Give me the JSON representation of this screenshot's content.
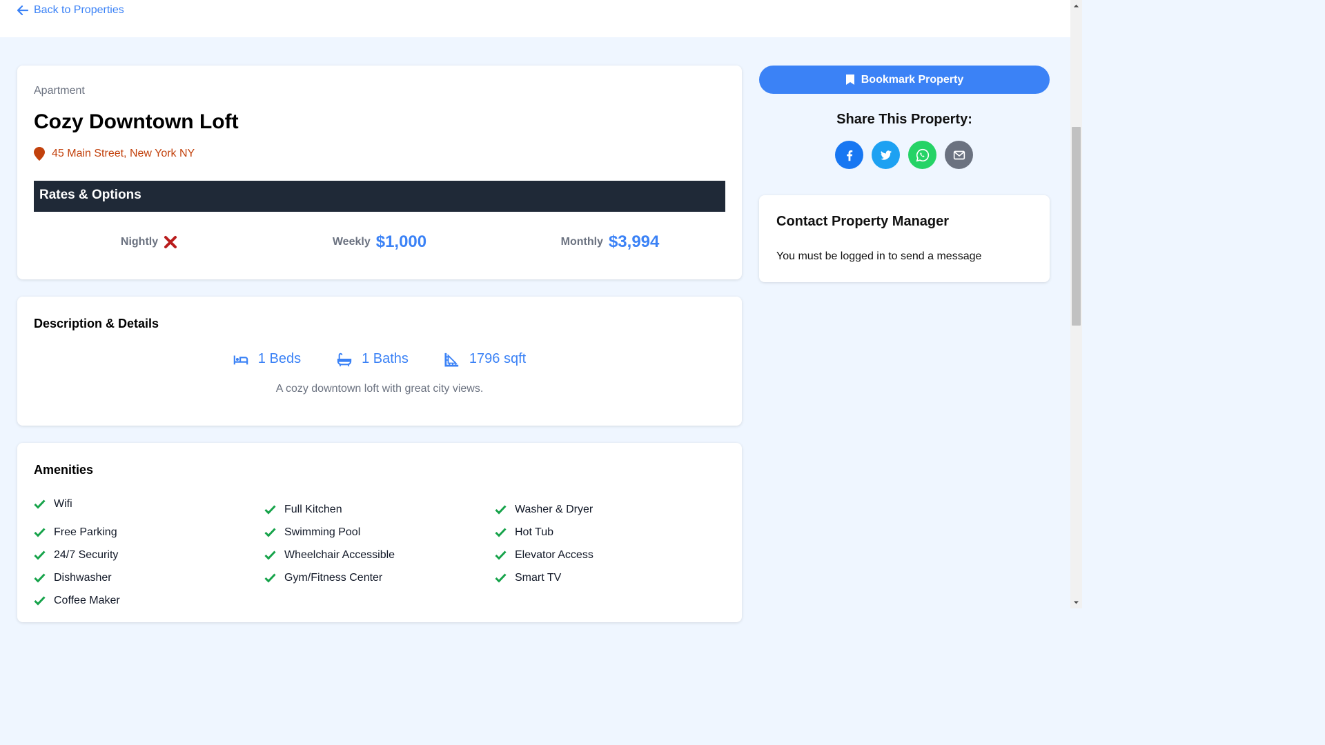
{
  "nav": {
    "back_label": "Back to Properties"
  },
  "property": {
    "type": "Apartment",
    "title": "Cozy Downtown Loft",
    "address": "45 Main Street, New York NY"
  },
  "rates": {
    "header": "Rates & Options",
    "nightly_label": "Nightly",
    "nightly_available": false,
    "weekly_label": "Weekly",
    "weekly_value": "$1,000",
    "monthly_label": "Monthly",
    "monthly_value": "$3,994"
  },
  "details": {
    "title": "Description & Details",
    "beds": "1 Beds",
    "baths": "1 Baths",
    "sqft": "1796 sqft",
    "description": "A cozy downtown loft with great city views."
  },
  "amenities": {
    "title": "Amenities",
    "columns": [
      [
        "Wifi",
        "Free Parking",
        "24/7 Security",
        "Dishwasher",
        "Coffee Maker"
      ],
      [
        "Full Kitchen",
        "Swimming Pool",
        "Wheelchair Accessible",
        "Gym/Fitness Center"
      ],
      [
        "Washer & Dryer",
        "Hot Tub",
        "Elevator Access",
        "Smart TV"
      ]
    ]
  },
  "sidebar": {
    "bookmark_label": "Bookmark Property",
    "share_title": "Share This Property:",
    "share_icons": [
      "facebook-icon",
      "twitter-icon",
      "whatsapp-icon",
      "email-icon"
    ],
    "contact_title": "Contact Property Manager",
    "contact_message": "You must be logged in to send a message"
  },
  "colors": {
    "accent": "#3b82f6",
    "address": "#c2410c",
    "rates_bar": "#1f2937",
    "check": "#16a34a",
    "x_mark": "#b91c1c",
    "facebook": "#1877f2",
    "twitter": "#1da1f2",
    "whatsapp": "#25d366",
    "email": "#6b7280"
  }
}
